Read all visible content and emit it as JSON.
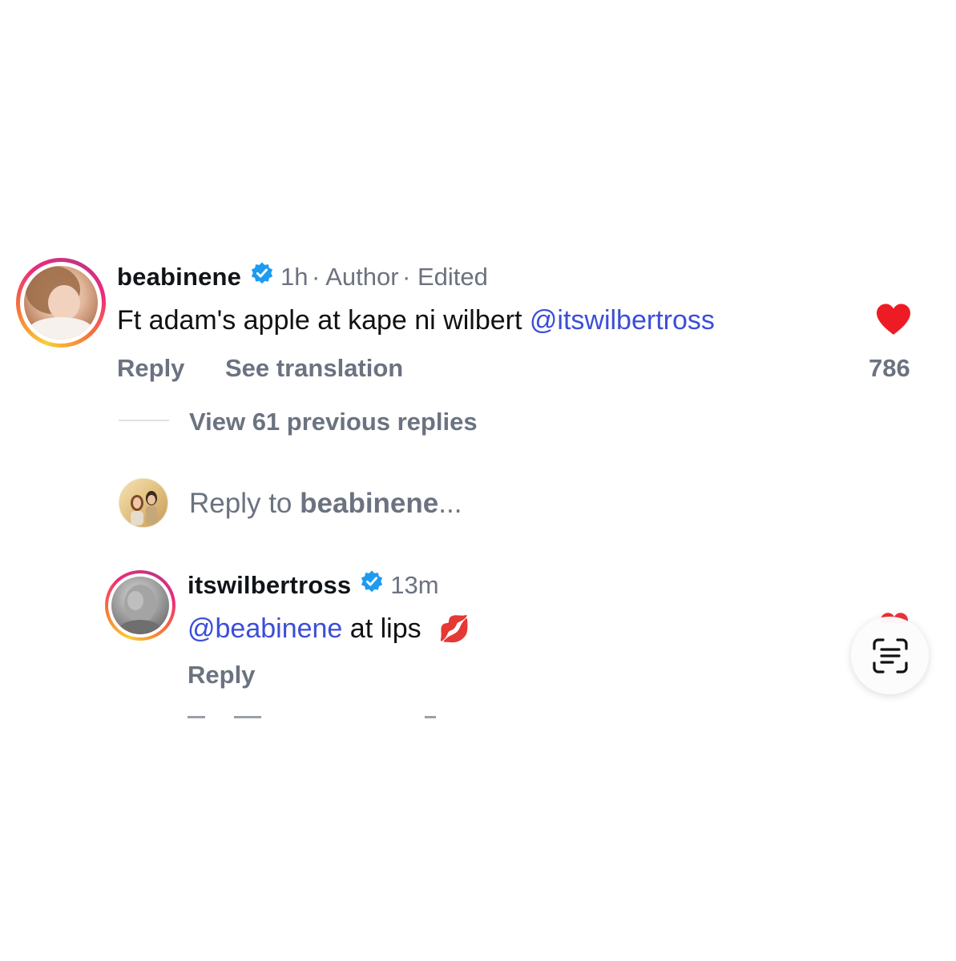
{
  "comments": [
    {
      "username": "beabinene",
      "time": "1h",
      "author_tag": "Author",
      "edited_tag": "Edited",
      "text": "Ft adam's apple at kape ni wilbert",
      "mention": "@itswilbertross",
      "reply_label": "Reply",
      "translate_label": "See translation",
      "like_count": "786",
      "liked": true
    }
  ],
  "thread": {
    "view_replies_label": "View 61 previous replies",
    "reply_input_prefix": "Reply to",
    "reply_input_username": "beabinene",
    "reply_input_suffix": "..."
  },
  "reply": {
    "username": "itswilbertross",
    "time": "13m",
    "mention": "@beabinene",
    "text": "at lips",
    "reply_label": "Reply",
    "emoji": "💋"
  },
  "colors": {
    "mention": "#3b4ed8",
    "muted": "#6b7280",
    "heart": "#ed1c24",
    "verified": "#1d9bf0"
  },
  "icons": [
    "verified-badge-icon",
    "heart-icon",
    "lips-emoji",
    "text-scan-icon"
  ]
}
